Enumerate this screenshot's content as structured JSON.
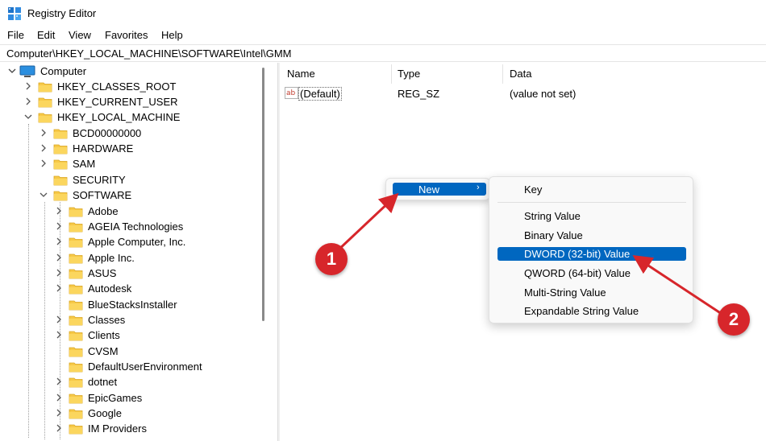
{
  "window": {
    "title": "Registry Editor",
    "icon": "registry-editor-icon"
  },
  "menu": [
    "File",
    "Edit",
    "View",
    "Favorites",
    "Help"
  ],
  "address": "Computer\\HKEY_LOCAL_MACHINE\\SOFTWARE\\Intel\\GMM",
  "tree": {
    "root": "Computer",
    "items": [
      "HKEY_CLASSES_ROOT",
      "HKEY_CURRENT_USER",
      "HKEY_LOCAL_MACHINE",
      "BCD00000000",
      "HARDWARE",
      "SAM",
      "SECURITY",
      "SOFTWARE",
      "Adobe",
      "AGEIA Technologies",
      "Apple Computer, Inc.",
      "Apple Inc.",
      "ASUS",
      "Autodesk",
      "BlueStacksInstaller",
      "Classes",
      "Clients",
      "CVSM",
      "DefaultUserEnvironment",
      "dotnet",
      "EpicGames",
      "Google",
      "IM Providers"
    ]
  },
  "list": {
    "headers": {
      "name": "Name",
      "type": "Type",
      "data": "Data"
    },
    "rows": [
      {
        "icon": "reg-sz-icon",
        "name": "(Default)",
        "type": "REG_SZ",
        "data": "(value not set)"
      }
    ]
  },
  "context_menu": {
    "new_label": "New",
    "arrow": "›",
    "submenu": [
      "Key",
      "String Value",
      "Binary Value",
      "DWORD (32-bit) Value",
      "QWORD (64-bit) Value",
      "Multi-String Value",
      "Expandable String Value"
    ],
    "highlighted": "DWORD (32-bit) Value"
  },
  "annotations": {
    "step1": "1",
    "step2": "2",
    "color": "#d7262b"
  }
}
